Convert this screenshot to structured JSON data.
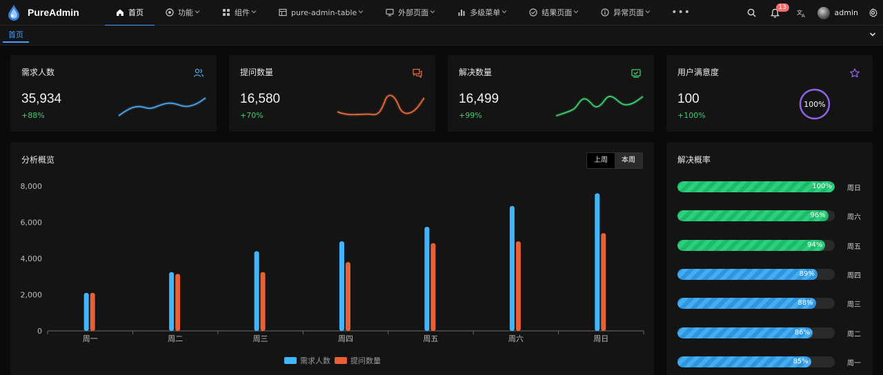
{
  "app": {
    "name": "PureAdmin"
  },
  "nav": {
    "items": [
      {
        "label": "首页",
        "icon": "home-icon",
        "active": true,
        "dropdown": false
      },
      {
        "label": "功能",
        "icon": "gear-circle-icon",
        "active": false,
        "dropdown": true
      },
      {
        "label": "组件",
        "icon": "grid-icon",
        "active": false,
        "dropdown": true
      },
      {
        "label": "pure-admin-table",
        "icon": "table-icon",
        "active": false,
        "dropdown": true
      },
      {
        "label": "外部页面",
        "icon": "monitor-icon",
        "active": false,
        "dropdown": true
      },
      {
        "label": "多级菜单",
        "icon": "bar-chart-icon",
        "active": false,
        "dropdown": true
      },
      {
        "label": "结果页面",
        "icon": "check-circle-icon",
        "active": false,
        "dropdown": true
      },
      {
        "label": "异常页面",
        "icon": "info-circle-icon",
        "active": false,
        "dropdown": true
      }
    ],
    "more": "•••",
    "notifications_count": "13",
    "user_name": "admin"
  },
  "tags": {
    "active": "首页"
  },
  "stats": [
    {
      "title": "需求人数",
      "value": "35,934",
      "change": "+88%",
      "color": "#4fa3e8",
      "icon": "users-icon"
    },
    {
      "title": "提问数量",
      "value": "16,580",
      "change": "+70%",
      "color": "#e86a3d",
      "icon": "chat-icon"
    },
    {
      "title": "解决数量",
      "value": "16,499",
      "change": "+99%",
      "color": "#3fcf6f",
      "icon": "check-square-icon"
    },
    {
      "title": "用户满意度",
      "value": "100",
      "change": "+100%",
      "color": "#8e63e8",
      "icon": "star-icon",
      "ring_percent": 100,
      "ring_label": "100%"
    }
  ],
  "overview": {
    "title": "分析概览",
    "toggle": [
      "上周",
      "本周"
    ],
    "toggle_selected": "本周"
  },
  "chart_data": {
    "type": "bar",
    "categories": [
      "周一",
      "周二",
      "周三",
      "周四",
      "周五",
      "周六",
      "周日"
    ],
    "series": [
      {
        "name": "需求人数",
        "color": "#41b6ff",
        "values": [
          2100,
          3250,
          4400,
          4950,
          5750,
          6900,
          7600
        ]
      },
      {
        "name": "提问数量",
        "color": "#e85f33",
        "values": [
          2100,
          3150,
          3250,
          3800,
          4850,
          4950,
          5400
        ]
      }
    ],
    "ylim": [
      0,
      8000
    ],
    "yticks": [
      "8,000",
      "6,000",
      "4,000",
      "2,000",
      "0"
    ],
    "legend": "bottom-center",
    "grid": false
  },
  "solve_rate": {
    "title": "解决概率",
    "rows": [
      {
        "day": "周日",
        "percent": 100,
        "label": "100%",
        "color": "green"
      },
      {
        "day": "周六",
        "percent": 96,
        "label": "96%",
        "color": "green"
      },
      {
        "day": "周五",
        "percent": 94,
        "label": "94%",
        "color": "green"
      },
      {
        "day": "周四",
        "percent": 89,
        "label": "89%",
        "color": "blue"
      },
      {
        "day": "周三",
        "percent": 88,
        "label": "88%",
        "color": "blue"
      },
      {
        "day": "周二",
        "percent": 86,
        "label": "86%",
        "color": "blue"
      },
      {
        "day": "周一",
        "percent": 85,
        "label": "85%",
        "color": "blue"
      }
    ]
  }
}
